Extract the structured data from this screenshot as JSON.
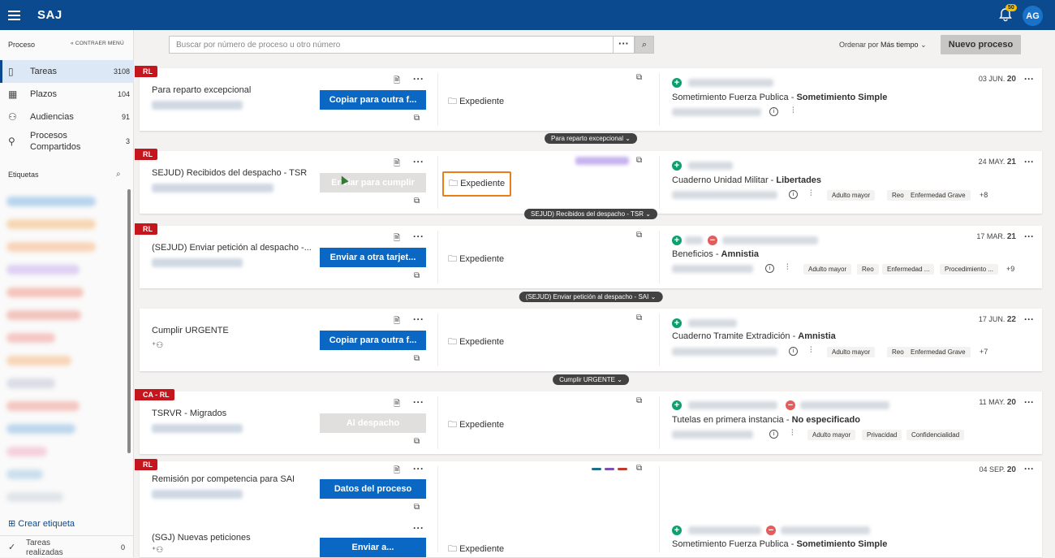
{
  "app": {
    "title": "SAJ",
    "notifications": "50",
    "user_initials": "AG"
  },
  "sidebar": {
    "header": "Proceso",
    "collapse": "CONTRAER MENÚ",
    "items": [
      {
        "label": "Tareas",
        "count": "3108",
        "icon": "tasks-icon"
      },
      {
        "label": "Plazos",
        "count": "104",
        "icon": "calendar-icon"
      },
      {
        "label": "Audiencias",
        "count": "91",
        "icon": "people-icon"
      },
      {
        "label": "Procesos Compartidos",
        "count": "3",
        "icon": "shared-icon"
      }
    ],
    "tags_header": "Etiquetas",
    "create_tag": "Crear etiqueta",
    "done_label": "Tareas realizadas",
    "done_count": "0"
  },
  "toolbar": {
    "search_placeholder": "Buscar por número de proceso u otro número",
    "sort_label": "Ordenar por",
    "sort_value": "Más tiempo",
    "new_button": "Nuevo proceso"
  },
  "cards": [
    {
      "badge": "RL",
      "title": "Para reparto excepcional",
      "action": "Copiar para outra f...",
      "action_enabled": true,
      "expediente": "Expediente",
      "date_day": "03 JUN.",
      "date_year": "20",
      "proc": "Sometimiento Fuerza Publica",
      "proc_bold": "Sometimiento Simple",
      "chips": [],
      "more": "",
      "group": "Para reparto excepcional"
    },
    {
      "badge": "RL",
      "title": "SEJUD) Recibidos del despacho - TSR",
      "action": "Enviar para cumplir",
      "action_enabled": false,
      "expediente": "Expediente",
      "date_day": "24 MAY.",
      "date_year": "21",
      "proc": "Cuaderno Unidad Militar",
      "proc_bold": "Libertades",
      "chips": [
        "Adulto mayor",
        "Reo",
        "Enfermedad Grave"
      ],
      "more": "+8",
      "group": "SEJUD) Recibidos del despacho - TSR"
    },
    {
      "badge": "RL",
      "title": "(SEJUD) Enviar petición al despacho -...",
      "action": "Enviar a otra tarjet...",
      "action_enabled": true,
      "expediente": "Expediente",
      "date_day": "17 MAR.",
      "date_year": "21",
      "proc": "Beneficios",
      "proc_bold": "Amnistia",
      "chips": [
        "Adulto mayor",
        "Reo",
        "Enfermedad ...",
        "Procedimiento ..."
      ],
      "more": "+9",
      "group": "(SEJUD) Enviar petición al despacho - SAI"
    },
    {
      "badge": "",
      "title": "Cumplir URGENTE",
      "action": "Copiar para outra f...",
      "action_enabled": true,
      "expediente": "Expediente",
      "date_day": "17 JUN.",
      "date_year": "22",
      "proc": "Cuaderno Tramite Extradición",
      "proc_bold": "Amnistia",
      "chips": [
        "Adulto mayor",
        "Reo",
        "Enfermedad Grave"
      ],
      "more": "+7",
      "group": "Cumplir URGENTE"
    },
    {
      "badge": "CA - RL",
      "title": "TSRVR - Migrados",
      "action": "Al despacho",
      "action_enabled": false,
      "expediente": "Expediente",
      "date_day": "11 MAY.",
      "date_year": "20",
      "proc": "Tutelas en primera instancia",
      "proc_bold": "No especificado",
      "chips": [
        "Adulto mayor",
        "Privacidad",
        "Confidencialidad"
      ],
      "more": "",
      "group": ""
    },
    {
      "badge": "RL",
      "title": "Remisión por competencia para SAI",
      "action": "Datos del proceso",
      "action_enabled": true,
      "title2": "(SGJ) Nuevas peticiones",
      "action2": "Enviar a...",
      "expediente": "Expediente",
      "date_day": "04 SEP.",
      "date_year": "20",
      "proc": "Sometimiento Fuerza Publica",
      "proc_bold": "Sometimiento Simple",
      "chips": [],
      "more": "",
      "group": ""
    }
  ],
  "colors": {
    "brand": "#0b4a8f",
    "primary": "#0a68c4",
    "badge": "#c4161c",
    "highlight": "#ea7d15"
  }
}
